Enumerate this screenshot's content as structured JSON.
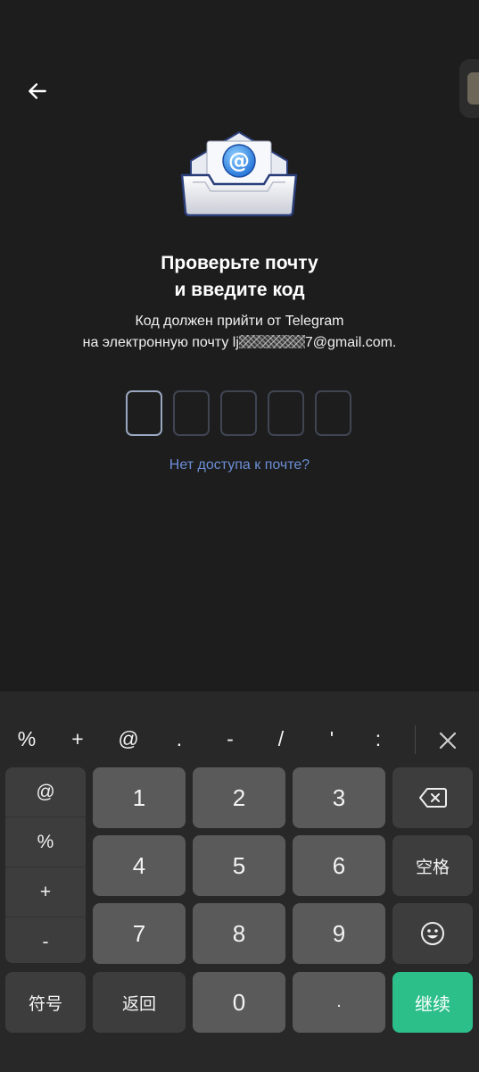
{
  "header": {
    "back_icon": "arrow-left-icon",
    "side_handle_icon": "side-panel-handle-icon"
  },
  "illustration": {
    "icon": "email-envelope-at-icon",
    "accent": "#2f8ef0"
  },
  "title": {
    "line1": "Проверьте почту",
    "line2": "и введите код"
  },
  "subtitle": {
    "line1": "Код должен прийти от Telegram",
    "line2_prefix": "на электронную почту lj",
    "line2_suffix": "7@gmail.com."
  },
  "code": {
    "length": 5,
    "active_index": 0
  },
  "no_access_link": "Нет доступа к почте?",
  "keyboard": {
    "symbols": [
      "%",
      "+",
      "@",
      ".",
      "-",
      "/",
      "'",
      ":"
    ],
    "close_icon": "close-icon",
    "side_symbols": [
      "@",
      "%",
      "+",
      "-"
    ],
    "digits": [
      "1",
      "2",
      "3",
      "4",
      "5",
      "6",
      "7",
      "8",
      "9",
      "0"
    ],
    "backspace_icon": "backspace-icon",
    "space_label": "空格",
    "emoji_icon": "smiley-icon",
    "symbols_label": "符号",
    "return_label": "返回",
    "dot_label": ".",
    "continue_label": "继续",
    "continue_color": "#2cbf8a"
  }
}
